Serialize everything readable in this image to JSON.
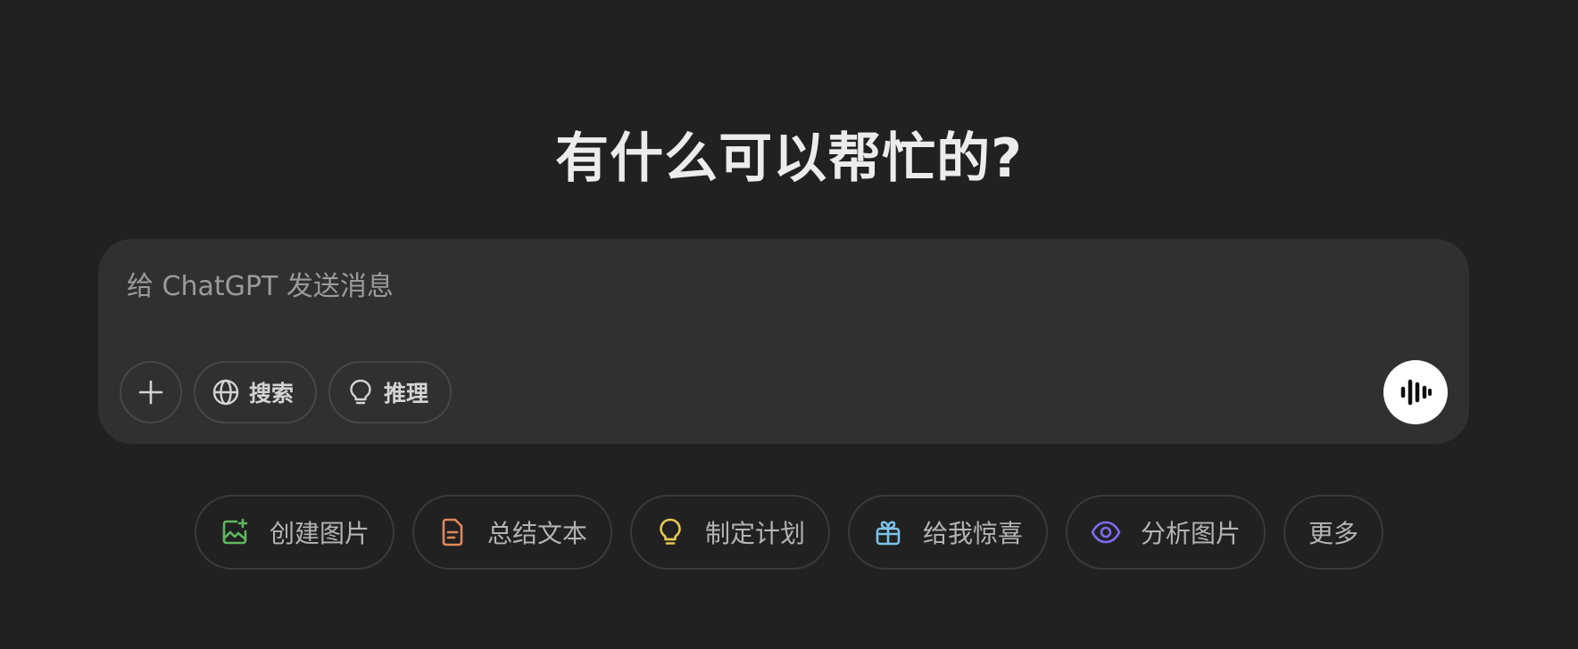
{
  "headline": "有什么可以帮忙的?",
  "composer": {
    "placeholder": "给 ChatGPT 发送消息",
    "value": "",
    "toolbar": {
      "add_icon": "plus-icon",
      "search": {
        "label": "搜索",
        "icon": "globe-icon"
      },
      "reason": {
        "label": "推理",
        "icon": "lightbulb-icon"
      }
    },
    "voice_icon": "voice-waveform-icon"
  },
  "suggestions": [
    {
      "label": "创建图片",
      "icon": "create-image-icon",
      "color": "#5fb760"
    },
    {
      "label": "总结文本",
      "icon": "document-icon",
      "color": "#e2875c"
    },
    {
      "label": "制定计划",
      "icon": "lightbulb-icon",
      "color": "#e6c74f"
    },
    {
      "label": "给我惊喜",
      "icon": "gift-icon",
      "color": "#7cc3e8"
    },
    {
      "label": "分析图片",
      "icon": "eye-icon",
      "color": "#7b6cf0"
    },
    {
      "label": "更多",
      "icon": "",
      "color": ""
    }
  ],
  "colors": {
    "background": "#212121",
    "composer": "#303030",
    "voice_button": "#ffffff"
  }
}
